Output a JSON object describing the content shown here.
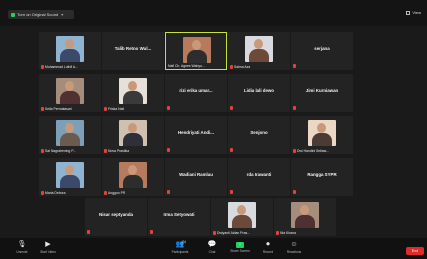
{
  "top": {
    "original_sound_label": "Turn on Original Sound",
    "view_label": "View"
  },
  "participants": [
    {
      "name": "Muhammad Luth A...",
      "video": true,
      "show_name_center": false,
      "label": "Muhammad Luthfi A...",
      "muted": true
    },
    {
      "name": "Talib Retno Wul...",
      "video": false,
      "show_name_center": true,
      "label": "",
      "muted": false
    },
    {
      "name": "Nafi Ch. Agnes Wahyu...",
      "video": true,
      "show_name_center": false,
      "label": "Nafi Ch. Agnes Wahyu...",
      "muted": false,
      "active": true
    },
    {
      "name": "Salma Aza...",
      "video": true,
      "show_name_center": false,
      "label": "Salma Aza",
      "muted": true
    },
    {
      "name": "serjana",
      "video": false,
      "show_name_center": true,
      "label": "",
      "muted": true
    },
    {
      "name": "Sella Permatasari",
      "video": true,
      "show_name_center": false,
      "label": "Sella Permatasari",
      "muted": true
    },
    {
      "name": "Friska Natt",
      "video": true,
      "show_name_center": false,
      "label": "Friska Natt",
      "muted": true
    },
    {
      "name": "rizi erika umar...",
      "video": false,
      "show_name_center": true,
      "label": "",
      "muted": true
    },
    {
      "name": "Lidia lali dewo",
      "video": false,
      "show_name_center": true,
      "label": "",
      "muted": true
    },
    {
      "name": "Jimi Kurniawan",
      "video": false,
      "show_name_center": true,
      "label": "",
      "muted": true
    },
    {
      "name": "Sal Nagrahening P...",
      "video": true,
      "show_name_center": false,
      "label": "Sal Nagrahening P...",
      "muted": true
    },
    {
      "name": "Nova Prastika",
      "video": true,
      "show_name_center": false,
      "label": "Nova Prastika",
      "muted": true
    },
    {
      "name": "Hendriyati Andi...",
      "video": false,
      "show_name_center": true,
      "label": "",
      "muted": true
    },
    {
      "name": "Senjono",
      "video": false,
      "show_name_center": true,
      "label": "",
      "muted": true
    },
    {
      "name": "Dwi Handini Setiaw...",
      "video": true,
      "show_name_center": false,
      "label": "Dwi Handini Setiaw...",
      "muted": true
    },
    {
      "name": "Maria Debora",
      "video": true,
      "show_name_center": false,
      "label": "Maria Debora",
      "muted": true
    },
    {
      "name": "Anggun PR",
      "video": true,
      "show_name_center": false,
      "label": "Anggun PR",
      "muted": true
    },
    {
      "name": "Wadiani Ramlau",
      "video": false,
      "show_name_center": true,
      "label": "",
      "muted": true
    },
    {
      "name": "rda Irawanti",
      "video": false,
      "show_name_center": true,
      "label": "",
      "muted": true
    },
    {
      "name": "Rangga SYPR",
      "video": false,
      "show_name_center": true,
      "label": "",
      "muted": true
    },
    {
      "name": "Nisar septyanda",
      "video": false,
      "show_name_center": true,
      "label": "",
      "muted": true
    },
    {
      "name": "Irma Setyowati",
      "video": false,
      "show_name_center": true,
      "label": "",
      "muted": true
    },
    {
      "name": "Dwiyanti Aldan Pras...",
      "video": true,
      "show_name_center": false,
      "label": "Dwiyanti Aldan Pras...",
      "muted": true
    },
    {
      "name": "Nia Kirana",
      "video": true,
      "show_name_center": false,
      "label": "Nia Kirana",
      "muted": true
    }
  ],
  "toolbar": {
    "unmute": "Unmute",
    "start_video": "Start Video",
    "participants": "Participants",
    "participants_count": "24",
    "chat": "Chat",
    "share_screen": "Share Screen",
    "record": "Record",
    "reactions": "Reactions",
    "end": "End"
  },
  "colors": {
    "accent_green": "#23d160",
    "active_border": "#c8e03c",
    "end_red": "#e02b2b",
    "tile_bg": "#232323"
  }
}
